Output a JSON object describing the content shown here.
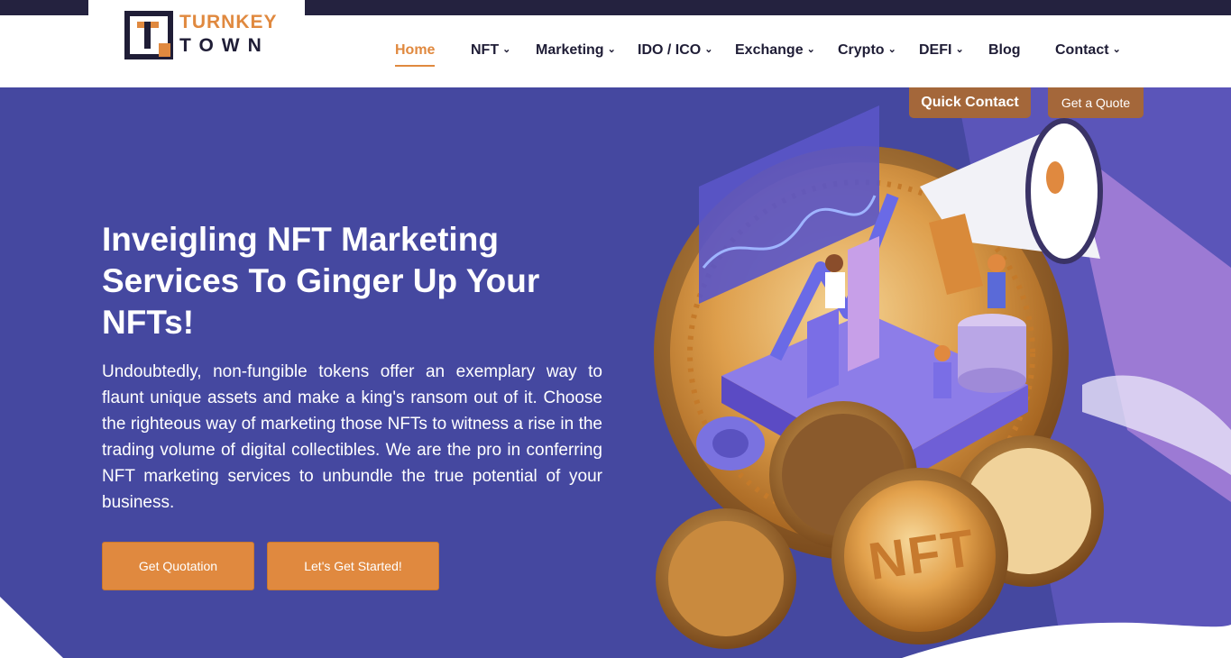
{
  "brand": {
    "name_top": "TURNKEY",
    "name_bottom": "TOWN",
    "colors": {
      "accent": "#e0893f",
      "dark": "#1f1d36",
      "hero_bg": "#4548a0",
      "tab_bg": "#a4673a"
    }
  },
  "nav": {
    "items": [
      {
        "label": "Home",
        "active": true,
        "dropdown": false
      },
      {
        "label": "NFT",
        "dropdown": true
      },
      {
        "label": "Marketing",
        "dropdown": true
      },
      {
        "label": "IDO / ICO",
        "dropdown": true
      },
      {
        "label": "Exchange",
        "dropdown": true
      },
      {
        "label": "Crypto",
        "dropdown": true
      },
      {
        "label": "DEFI",
        "dropdown": true
      },
      {
        "label": "Blog",
        "dropdown": false
      },
      {
        "label": "Contact",
        "dropdown": true
      }
    ],
    "chevron_icon": "chevron-down-icon"
  },
  "side_tabs": {
    "quick_contact": "Quick Contact",
    "get_quote": "Get a Quote"
  },
  "hero": {
    "title": "Inveigling NFT Marketing Services To Ginger Up Your NFTs!",
    "description": "Undoubtedly, non-fungible tokens offer an exemplary way to flaunt unique assets and make a king's ransom out of it. Choose the righteous way of marketing those NFTs to witness a rise in the trading volume of digital collectibles. We are the pro in conferring NFT marketing services to unbundle the true potential of your business.",
    "buttons": {
      "quotation": "Get Quotation",
      "started": "Let's Get Started!"
    },
    "illustration": {
      "coin_text": "NFT"
    }
  }
}
